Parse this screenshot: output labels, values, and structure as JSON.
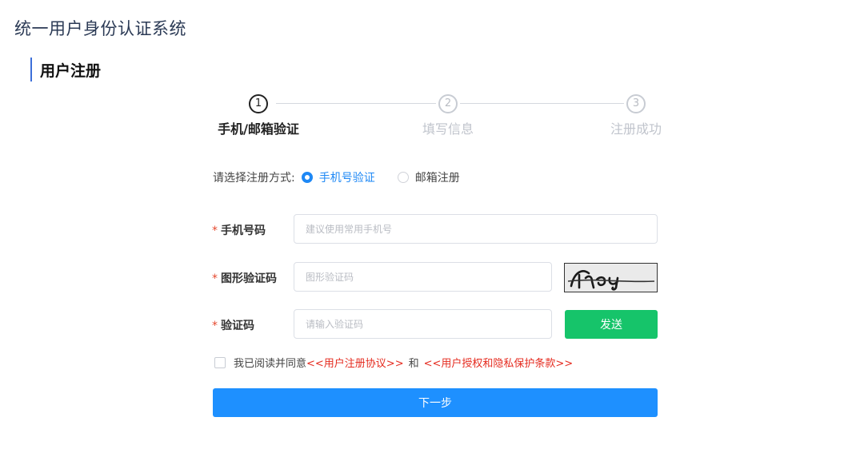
{
  "header": {
    "title": "统一用户身份认证系统"
  },
  "section": {
    "title": "用户注册"
  },
  "steps": [
    {
      "number": "1",
      "label": "手机/邮箱验证",
      "active": true
    },
    {
      "number": "2",
      "label": "填写信息",
      "active": false
    },
    {
      "number": "3",
      "label": "注册成功",
      "active": false
    }
  ],
  "method": {
    "label": "请选择注册方式:",
    "options": [
      {
        "label": "手机号验证",
        "selected": true
      },
      {
        "label": "邮箱注册",
        "selected": false
      }
    ]
  },
  "form": {
    "phone": {
      "label": "手机号码",
      "placeholder": "建议使用常用手机号",
      "value": ""
    },
    "captcha": {
      "label": "图形验证码",
      "placeholder": "图形验证码",
      "value": ""
    },
    "code": {
      "label": "验证码",
      "placeholder": "请输入验证码",
      "value": ""
    },
    "required_mark": "*",
    "send_label": "发送"
  },
  "agreement": {
    "prefix": "我已阅读并同意",
    "link1": "<<用户注册协议>>",
    "and": "和",
    "link2": "<<用户授权和隐私保护条款>>"
  },
  "next_label": "下一步",
  "colors": {
    "primary": "#1e90ff",
    "send": "#16c46a",
    "link": "#e52b1f",
    "required": "#e5482e"
  }
}
